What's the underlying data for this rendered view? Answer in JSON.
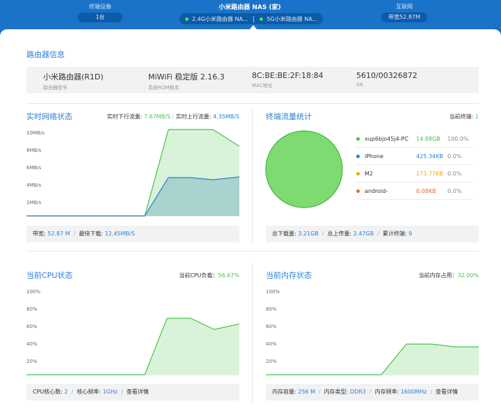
{
  "topbar": {
    "devices": {
      "title": "终端设备",
      "value": "1台"
    },
    "router": {
      "title": "小米路由器 NAS (家)",
      "wifi24": "2.4G小米路由器 NA...",
      "wifi5": "5G小米路由器 NA..."
    },
    "internet": {
      "title": "互联网",
      "value": "带宽52.87M"
    }
  },
  "router_info": {
    "title": "路由器信息",
    "fields": [
      {
        "value": "小米路由器(R1D)",
        "label": "路由器型号"
      },
      {
        "value": "MiWiFi 稳定版 2.16.3",
        "label": "系统ROM版本"
      },
      {
        "value": "8C:BE:BE:2F:18:84",
        "label": "MAC地址"
      },
      {
        "value": "5610/00326872",
        "label": "SN"
      }
    ]
  },
  "network": {
    "title": "实时网络状态",
    "down_label": "实时下行流量: ",
    "down_value": "7.67MB/S",
    "up_label": "实时上行流量: ",
    "up_value": "4.35MB/S",
    "y_ticks": [
      "10MB/s",
      "8MB/s",
      "6MB/s",
      "4MB/s",
      "2MB/s"
    ],
    "footer": {
      "bw_label": "带宽: ",
      "bw_value": "52.87 M",
      "max_label": "最快下载: ",
      "max_value": "12.45MB/S"
    }
  },
  "traffic": {
    "title": "终端流量统计",
    "current_label": "当前终端: ",
    "current_value": "1",
    "items": [
      {
        "name": "xup6bjo45j4-PC",
        "size": "14.88GB",
        "percent": "100.0%",
        "color": "#4bbf4b"
      },
      {
        "name": "iPhone",
        "size": "425.34KB",
        "percent": "0.0%",
        "color": "#2a7fd4"
      },
      {
        "name": "M2",
        "size": "173.77KB",
        "percent": "0.0%",
        "color": "#f0a30a"
      },
      {
        "name": "android-",
        "size": "0.08KB",
        "percent": "0.0%",
        "color": "#f06a1e"
      }
    ],
    "footer": {
      "down_label": "总下载量: ",
      "down_value": "3.21GB",
      "up_label": "总上传量: ",
      "up_value": "2.47GB",
      "acc_label": "累计终端: ",
      "acc_value": "9"
    }
  },
  "cpu": {
    "title": "当前CPU状态",
    "load_label": "当前CPU负载：",
    "load_value": "56.67%",
    "y_ticks": [
      "100%",
      "80%",
      "60%",
      "40%",
      "20%"
    ],
    "footer": {
      "cores_label": "CPU核心数: ",
      "cores_value": "2",
      "freq_label": "核心频率: ",
      "freq_value": "1GHz",
      "detail": "查看详情"
    }
  },
  "memory": {
    "title": "当前内存状态",
    "usage_label": "当前内存占用：",
    "usage_value": "32.00%",
    "y_ticks": [
      "100%",
      "80%",
      "60%",
      "40%",
      "20%"
    ],
    "footer": {
      "cap_label": "内存容量: ",
      "cap_value": "256 M",
      "type_label": "内存类型: ",
      "type_value": "DDR3",
      "freq_label": "内存频率: ",
      "freq_value": "1600MHz",
      "detail": "查看详情"
    }
  }
}
